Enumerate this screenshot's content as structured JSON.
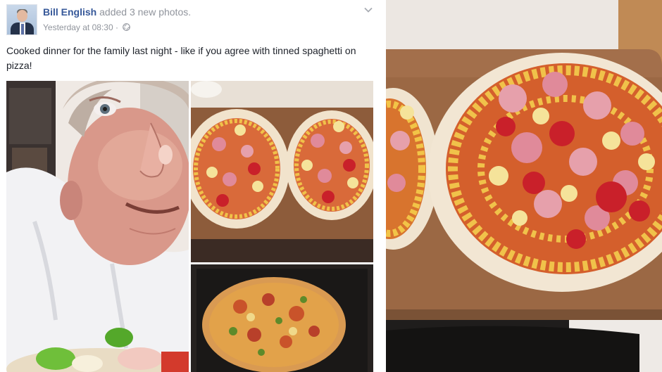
{
  "post": {
    "author": "Bill English",
    "action": "added 3 new photos.",
    "timestamp": "Yesterday at 08:30",
    "separator": "·",
    "privacy_icon": "globe-icon",
    "menu_icon": "chevron-down-icon",
    "caption": "Cooked dinner for the family last night - like if you agree with tinned spaghetti on pizza!"
  },
  "photos": [
    {
      "subject": "selfie-with-pizza"
    },
    {
      "subject": "two-uncooked-pizzas"
    },
    {
      "subject": "cooked-pizza"
    },
    {
      "subject": "uncooked-pizza-closeup"
    }
  ],
  "colors": {
    "author_link": "#365899",
    "meta_text": "#90949c",
    "body_text": "#1d2129"
  }
}
